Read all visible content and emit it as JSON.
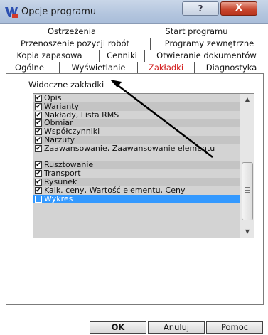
{
  "window": {
    "title": "Opcje programu",
    "help_label": "?",
    "close_label": "X"
  },
  "tabs": {
    "row1": [
      "Ostrzeżenia",
      "Start programu"
    ],
    "row2": [
      "Przenoszenie pozycji robót",
      "Programy zewnętrzne"
    ],
    "row3": [
      "Kopia zapasowa",
      "Cenniki",
      "Otwieranie dokumentów"
    ],
    "row4": [
      "Ogólne",
      "Wyświetlanie",
      "Zakładki",
      "Diagnostyka"
    ],
    "active": "Zakładki"
  },
  "group": {
    "label": "Widoczne zakładki"
  },
  "list": {
    "items": [
      {
        "label": "Opis",
        "checked": true
      },
      {
        "label": "Warianty",
        "checked": true
      },
      {
        "label": "Nakłady, Lista RMS",
        "checked": true
      },
      {
        "label": "Obmiar",
        "checked": true
      },
      {
        "label": "Współczynniki",
        "checked": true
      },
      {
        "label": "Narzuty",
        "checked": true
      },
      {
        "label": "Zaawansowanie, Zaawansowanie elementu",
        "checked": true
      },
      {
        "label": "Rusztowanie",
        "checked": true
      },
      {
        "label": "Transport",
        "checked": true
      },
      {
        "label": "Rysunek",
        "checked": true
      },
      {
        "label": "Kalk. ceny, Wartość elementu, Ceny",
        "checked": true
      },
      {
        "label": "Wykres",
        "checked": false
      }
    ],
    "selected_index": 11
  },
  "footer": {
    "ok_label": "OK",
    "cancel_label": "Anuluj",
    "help_label": "Pomoc"
  },
  "colors": {
    "active_tab_text": "#d21c1c",
    "selection": "#3399ff",
    "arrow": "#000000"
  }
}
